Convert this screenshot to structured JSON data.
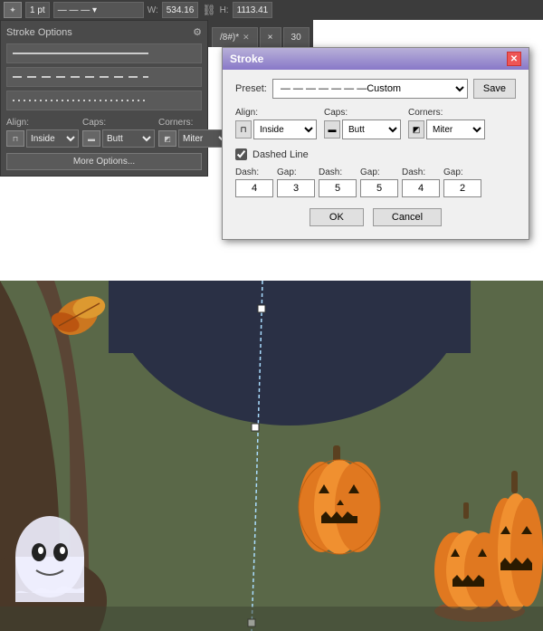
{
  "toolbar": {
    "stroke_weight_label": "1 pt",
    "width_label": "W:",
    "width_value": "534.16",
    "height_label": "H:",
    "height_value": "1113.41"
  },
  "stroke_options": {
    "title": "Stroke Options",
    "lines": [
      "solid",
      "dashed",
      "dotted"
    ],
    "align_label": "Align:",
    "caps_label": "Caps:",
    "corners_label": "Corners:",
    "align_value": "Inside",
    "caps_value": "Butt",
    "corners_value": "Miter",
    "more_options_label": "More Options..."
  },
  "stroke_dialog": {
    "title": "Stroke",
    "close_label": "✕",
    "preset_label": "Preset:",
    "preset_value": "— — — — — — —Custom",
    "save_label": "Save",
    "align_label": "Align:",
    "align_value": "Inside",
    "caps_label": "Caps:",
    "caps_value": "Butt",
    "corners_label": "Corners:",
    "corners_value": "Miter",
    "dashed_line_label": "Dashed Line",
    "dash1_label": "Dash:",
    "gap1_label": "Gap:",
    "dash2_label": "Dash:",
    "gap2_label": "Gap:",
    "dash3_label": "Dash:",
    "gap3_label": "Gap:",
    "dash1_value": "4",
    "gap1_value": "3",
    "dash2_value": "5",
    "gap2_value": "5",
    "dash3_value": "4",
    "gap3_value": "2",
    "ok_label": "OK",
    "cancel_label": "Cancel"
  },
  "tabs": [
    {
      "label": "/8#)*",
      "active": false
    },
    {
      "label": "×",
      "active": false
    },
    {
      "label": "30",
      "active": false
    }
  ],
  "canvas": {
    "bg_color": "#5a6548"
  }
}
